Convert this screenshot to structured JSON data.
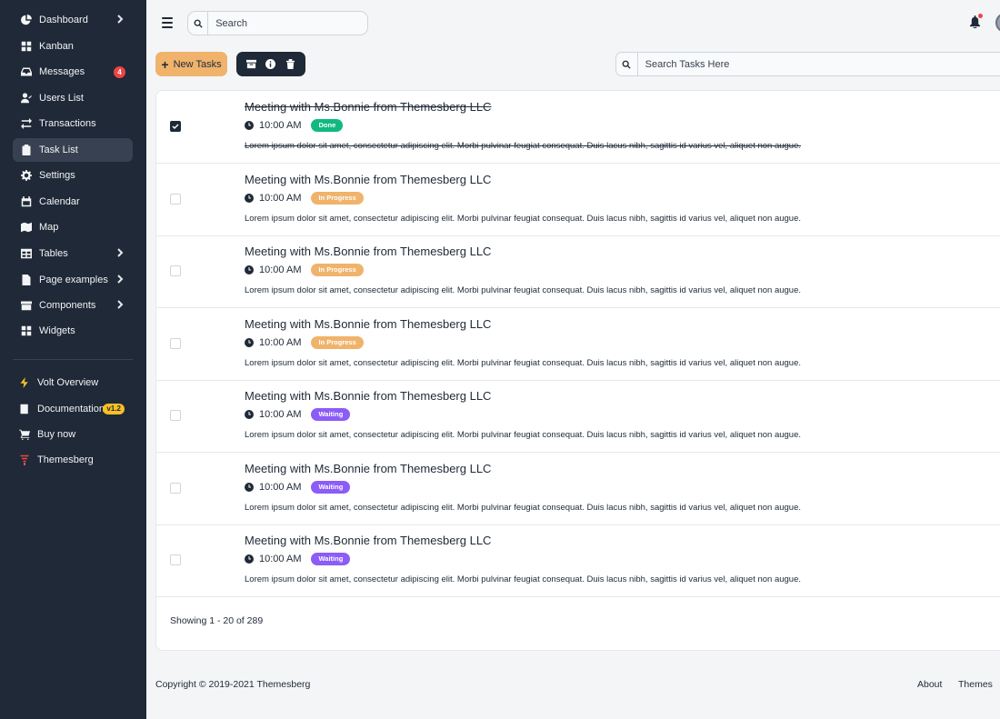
{
  "sidebar": {
    "items": [
      {
        "label": "Dashboard",
        "icon": "pie-chart-icon"
      },
      {
        "label": "Kanban",
        "icon": "grid-icon"
      },
      {
        "label": "Messages",
        "icon": "inbox-icon",
        "badge": "4"
      },
      {
        "label": "Users List",
        "icon": "user-icon"
      },
      {
        "label": "Transactions",
        "icon": "transactions-icon"
      },
      {
        "label": "Task List",
        "icon": "clipboard-icon"
      },
      {
        "label": "Settings",
        "icon": "gear-icon"
      },
      {
        "label": "Calendar",
        "icon": "calendar-icon"
      },
      {
        "label": "Map",
        "icon": "map-icon"
      },
      {
        "label": "Tables",
        "icon": "table-icon"
      },
      {
        "label": "Page examples",
        "icon": "document-icon"
      },
      {
        "label": "Components",
        "icon": "archive-icon"
      },
      {
        "label": "Widgets",
        "icon": "widgets-icon"
      }
    ],
    "bottom": [
      {
        "label": "Volt Overview",
        "icon": "lightning-icon"
      },
      {
        "label": "Documentation",
        "icon": "book-icon",
        "badge": "v1.2"
      },
      {
        "label": "Buy now",
        "icon": "cart-icon"
      },
      {
        "label": "Themesberg",
        "icon": "themesberg-logo-icon"
      }
    ]
  },
  "header": {
    "search_placeholder": "Search"
  },
  "toolbar": {
    "new_task_label": "New Tasks",
    "task_search_placeholder": "Search Tasks Here"
  },
  "tasks": [
    {
      "title": "Meeting with Ms.Bonnie from Themesberg LLC",
      "time": "10:00 AM",
      "status": "Done",
      "description": "Lorem ipsum dolor sit amet, consectetur adipiscing elit. Morbi pulvinar feugiat consequat. Duis lacus nibh, sagittis id varius vel, aliquet non augue.",
      "checked": true
    },
    {
      "title": "Meeting with Ms.Bonnie from Themesberg LLC",
      "time": "10:00 AM",
      "status": "In Progress",
      "description": "Lorem ipsum dolor sit amet, consectetur adipiscing elit. Morbi pulvinar feugiat consequat. Duis lacus nibh, sagittis id varius vel, aliquet non augue.",
      "checked": false
    },
    {
      "title": "Meeting with Ms.Bonnie from Themesberg LLC",
      "time": "10:00 AM",
      "status": "In Progress",
      "description": "Lorem ipsum dolor sit amet, consectetur adipiscing elit. Morbi pulvinar feugiat consequat. Duis lacus nibh, sagittis id varius vel, aliquet non augue.",
      "checked": false
    },
    {
      "title": "Meeting with Ms.Bonnie from Themesberg LLC",
      "time": "10:00 AM",
      "status": "In Progress",
      "description": "Lorem ipsum dolor sit amet, consectetur adipiscing elit. Morbi pulvinar feugiat consequat. Duis lacus nibh, sagittis id varius vel, aliquet non augue.",
      "checked": false
    },
    {
      "title": "Meeting with Ms.Bonnie from Themesberg LLC",
      "time": "10:00 AM",
      "status": "Waiting",
      "description": "Lorem ipsum dolor sit amet, consectetur adipiscing elit. Morbi pulvinar feugiat consequat. Duis lacus nibh, sagittis id varius vel, aliquet non augue.",
      "checked": false
    },
    {
      "title": "Meeting with Ms.Bonnie from Themesberg LLC",
      "time": "10:00 AM",
      "status": "Waiting",
      "description": "Lorem ipsum dolor sit amet, consectetur adipiscing elit. Morbi pulvinar feugiat consequat. Duis lacus nibh, sagittis id varius vel, aliquet non augue.",
      "checked": false
    },
    {
      "title": "Meeting with Ms.Bonnie from Themesberg LLC",
      "time": "10:00 AM",
      "status": "Waiting",
      "description": "Lorem ipsum dolor sit amet, consectetur adipiscing elit. Morbi pulvinar feugiat consequat. Duis lacus nibh, sagittis id varius vel, aliquet non augue.",
      "checked": false
    }
  ],
  "pagination": {
    "showing_text": "Showing 1 - 20 of 289"
  },
  "footer": {
    "copyright": "Copyright © 2019-2021 Themesberg",
    "links": [
      "About",
      "Themes"
    ]
  },
  "colors": {
    "sidebar_bg": "#1f2937",
    "accent": "#f0b36b",
    "done": "#10b981",
    "waiting": "#8b5cf6",
    "notification": "#ef4444"
  }
}
